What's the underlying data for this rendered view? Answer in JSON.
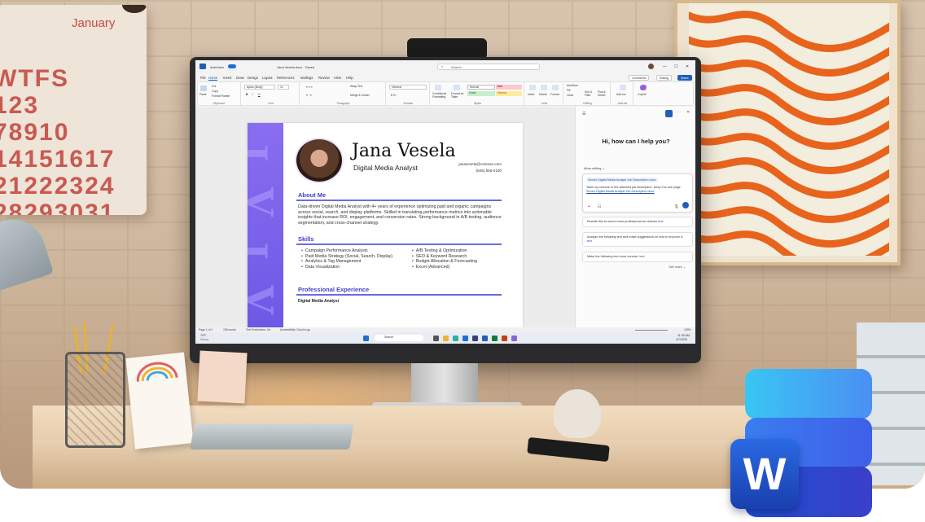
{
  "calendar": {
    "month": "January",
    "rows": [
      "WTFS",
      "123",
      "78910",
      "14151617",
      "21222324",
      "28293031"
    ]
  },
  "word": {
    "titlebar": {
      "autosave": "AutoSave",
      "docname": "Jana Vesela.docx · Saved",
      "search_placeholder": "Search"
    },
    "menu_tabs": [
      "File",
      "Home",
      "Insert",
      "Draw",
      "Design",
      "Layout",
      "References",
      "Mailings",
      "Review",
      "View",
      "Help"
    ],
    "buttons": {
      "comments": "Comments",
      "editing": "Editing",
      "share": "Share"
    },
    "ribbon": {
      "clipboard": {
        "label": "Clipboard",
        "paste": "Paste",
        "cut": "Cut",
        "copy": "Copy",
        "format_painter": "Format Painter"
      },
      "font": {
        "label": "Font",
        "name": "Aptos (Body)",
        "size": "11"
      },
      "paragraph": {
        "label": "Paragraph",
        "wrap": "Wrap Text",
        "merge": "Merge & Center"
      },
      "number": {
        "label": "Number",
        "format": "General"
      },
      "styles": {
        "label": "Styles",
        "conditional": "Conditional Formatting",
        "format_table": "Format as Table",
        "normal": "Normal",
        "bad": "Bad",
        "good": "Good",
        "neutral": "Neutral"
      },
      "cells": {
        "label": "Cells",
        "insert": "Insert",
        "delete": "Delete",
        "format": "Format"
      },
      "editing": {
        "label": "Editing",
        "autosum": "AutoSum",
        "fill": "Fill",
        "clear": "Clear",
        "sort": "Sort & Filter",
        "find": "Find & Select"
      },
      "addins": {
        "label": "Add-ins",
        "addins": "Add-ins"
      },
      "copilot": {
        "label": "Copilot"
      }
    },
    "resume": {
      "name": "Jana Vesela",
      "role": "Digital Media Analyst",
      "email": "janavesela@contoso.com",
      "phone": "(845) 555-0100",
      "about_title": "About Me",
      "about_text": "Data-driven Digital Media Analyst with 4+ years of experience optimizing paid and organic campaigns across social, search, and display platforms. Skilled in translating performance metrics into actionable insights that increase ROI, engagement, and conversion rates. Strong background in A/B testing, audience segmentation, and cross-channel strategy.",
      "skills_title": "Skills",
      "skills_left": [
        "Campaign Performance Analysis",
        "Paid Media Strategy (Social, Search, Display)",
        "Analytics & Tag Management",
        "Data Visualization"
      ],
      "skills_right": [
        "A/B Testing & Optimization",
        "SEO & Keyword Research",
        "Budget Allocation & Forecasting",
        "Excel (Advanced)"
      ],
      "experience_title": "Professional Experience",
      "job_title": "Digital Media Analyst"
    },
    "copilot": {
      "greeting": "Hi, how can I help you?",
      "mode": "Allow editing",
      "chip": "Senior Digital Media Analyst Job Description.docx",
      "prompt": "Tailor my resume to the attached job description. Keep it to one page.",
      "prompt_link": "Senior Digital Media Analyst Job Description.docx",
      "suggestions": [
        {
          "text": "Rewrite this to sound more professional as verbose ",
          "link": "text"
        },
        {
          "text": "Analyze the following text and make suggestions on how to improve it: ",
          "link": "text"
        },
        {
          "text": "Make the following text more concise: ",
          "link": "text"
        }
      ],
      "see_more": "See more"
    },
    "status": {
      "page": "Page 1 of 1",
      "words": "238 words",
      "predictions": "Text Predictions: On",
      "accessibility": "Accessibility: Good to go",
      "zoom": "100%"
    },
    "taskbar": {
      "temp": "70°F",
      "weather": "Sunny",
      "search": "Search",
      "time": "11:30 AM",
      "date": "4/7/2025"
    }
  },
  "colors": {
    "accent": "#6b5ce7",
    "word_blue": "#1f5fb8"
  }
}
